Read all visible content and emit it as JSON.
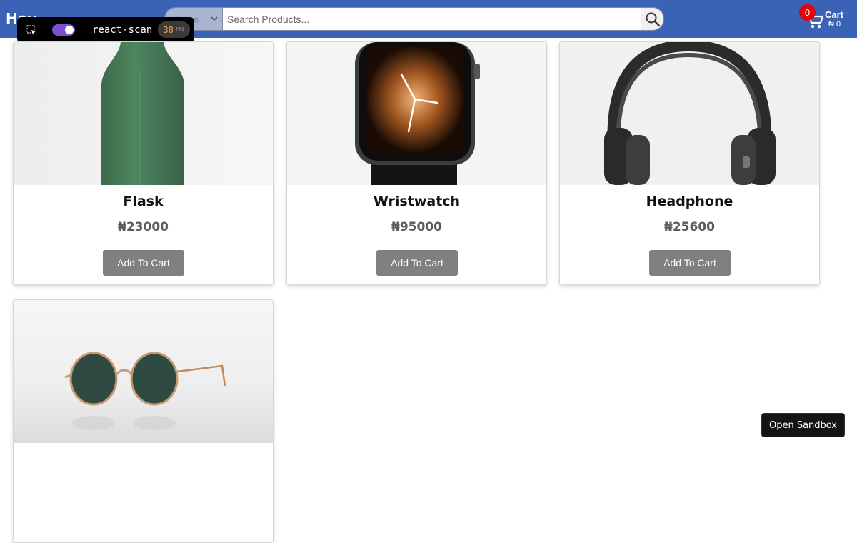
{
  "header": {
    "logo_text": "Hey",
    "search": {
      "category_value": "Home",
      "placeholder": "Search Products...",
      "search_icon": "magnifier-icon"
    },
    "cart": {
      "icon": "shopping-cart-icon",
      "count": "0",
      "label": "Cart",
      "total": "₦ 0"
    }
  },
  "react_scan": {
    "label": "react-scan",
    "fps_value": "38",
    "fps_unit": "FPS",
    "toggle_on": true
  },
  "products": [
    {
      "name": "Flask",
      "price": "₦23000",
      "button": "Add To Cart",
      "image": "green-flask"
    },
    {
      "name": "Wristwatch",
      "price": "₦95000",
      "button": "Add To Cart",
      "image": "smartwatch"
    },
    {
      "name": "Headphone",
      "price": "₦25600",
      "button": "Add To Cart",
      "image": "headphones"
    },
    {
      "name": "",
      "price": "",
      "button": "",
      "image": "sunglasses"
    }
  ],
  "sandbox_button": "Open Sandbox",
  "colors": {
    "header_bg": "#3a62b5",
    "cart_badge": "#e8000b",
    "add_button": "#808080",
    "toggle_accent": "#7b4fcf"
  }
}
